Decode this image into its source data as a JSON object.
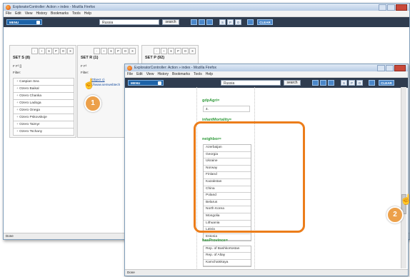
{
  "back_window": {
    "title": "ExploratorController: Action » index - Mozilla Firefox",
    "menu": [
      "File",
      "Edit",
      "View",
      "History",
      "Bookmarks",
      "Tools",
      "Help"
    ],
    "toolbar": {
      "menu_label": "MENU",
      "search_value": "Russia",
      "search_button": "search",
      "spo_labels": [
        "S",
        "P",
        "O"
      ],
      "clear_label": "CLEAR"
    },
    "sets": [
      {
        "title": "SET S (8)",
        "toggles": "F  F²  []",
        "filter_label": "Filter:",
        "items": [
          "Caspian Sea",
          "Ozero Baikal",
          "Ozero Chanka",
          "Ozero Ladoga",
          "Ozero Onega",
          "Ozero Pskovskoje",
          "Ozero Taimyr",
          "Ozero Tschany"
        ]
      },
      {
        "title": "SET R (1)",
        "toggles": "F  F²",
        "filter_label": "Filter:",
        "items": [
          "(Object c)",
          "<//www.semwebtech"
        ]
      },
      {
        "title": "SET P (92)",
        "toggles": "F  F²",
        "filter_label": "Filter:",
        "items": []
      }
    ],
    "panel_buttons": [
      "-",
      "+",
      "S",
      "P",
      "O",
      "X"
    ],
    "status": "Done"
  },
  "front_window": {
    "title": "ExploratorController: Action » index - Mozilla Firefox",
    "menu": [
      "File",
      "Edit",
      "View",
      "History",
      "Bookmarks",
      "Tools",
      "Help"
    ],
    "toolbar": {
      "menu_label": "MENU",
      "search_value": "Russia",
      "search_button": "search",
      "spo_labels": [
        "S",
        "P",
        "O"
      ],
      "clear_label": "CLEAR"
    },
    "attributes": [
      {
        "name": "gdpAgri=",
        "value": "4."
      },
      {
        "name": "infantMortality="
      },
      {
        "name": "neighbor=",
        "values": [
          "Azerbaijan",
          "Georgia",
          "Ukraine",
          "Norway",
          "Finland",
          "Kazakstan",
          "China",
          "Poland",
          "Belarus",
          "North Korea",
          "Mongolia",
          "Lithuania",
          "Latvia",
          "Estonia"
        ]
      },
      {
        "name": "hasProvince=",
        "values": [
          "Rep. of Bashkortostan",
          "Rep. of Altay",
          "Kamchatskaya"
        ]
      }
    ],
    "status": "Done"
  },
  "badges": {
    "one": "1",
    "two": "2"
  },
  "colors": {
    "toolbar_bg": "#2f3c4f",
    "highlight": "#ec7d1a",
    "attribute_green": "#2f9a3a",
    "badge": "#eca04a"
  }
}
